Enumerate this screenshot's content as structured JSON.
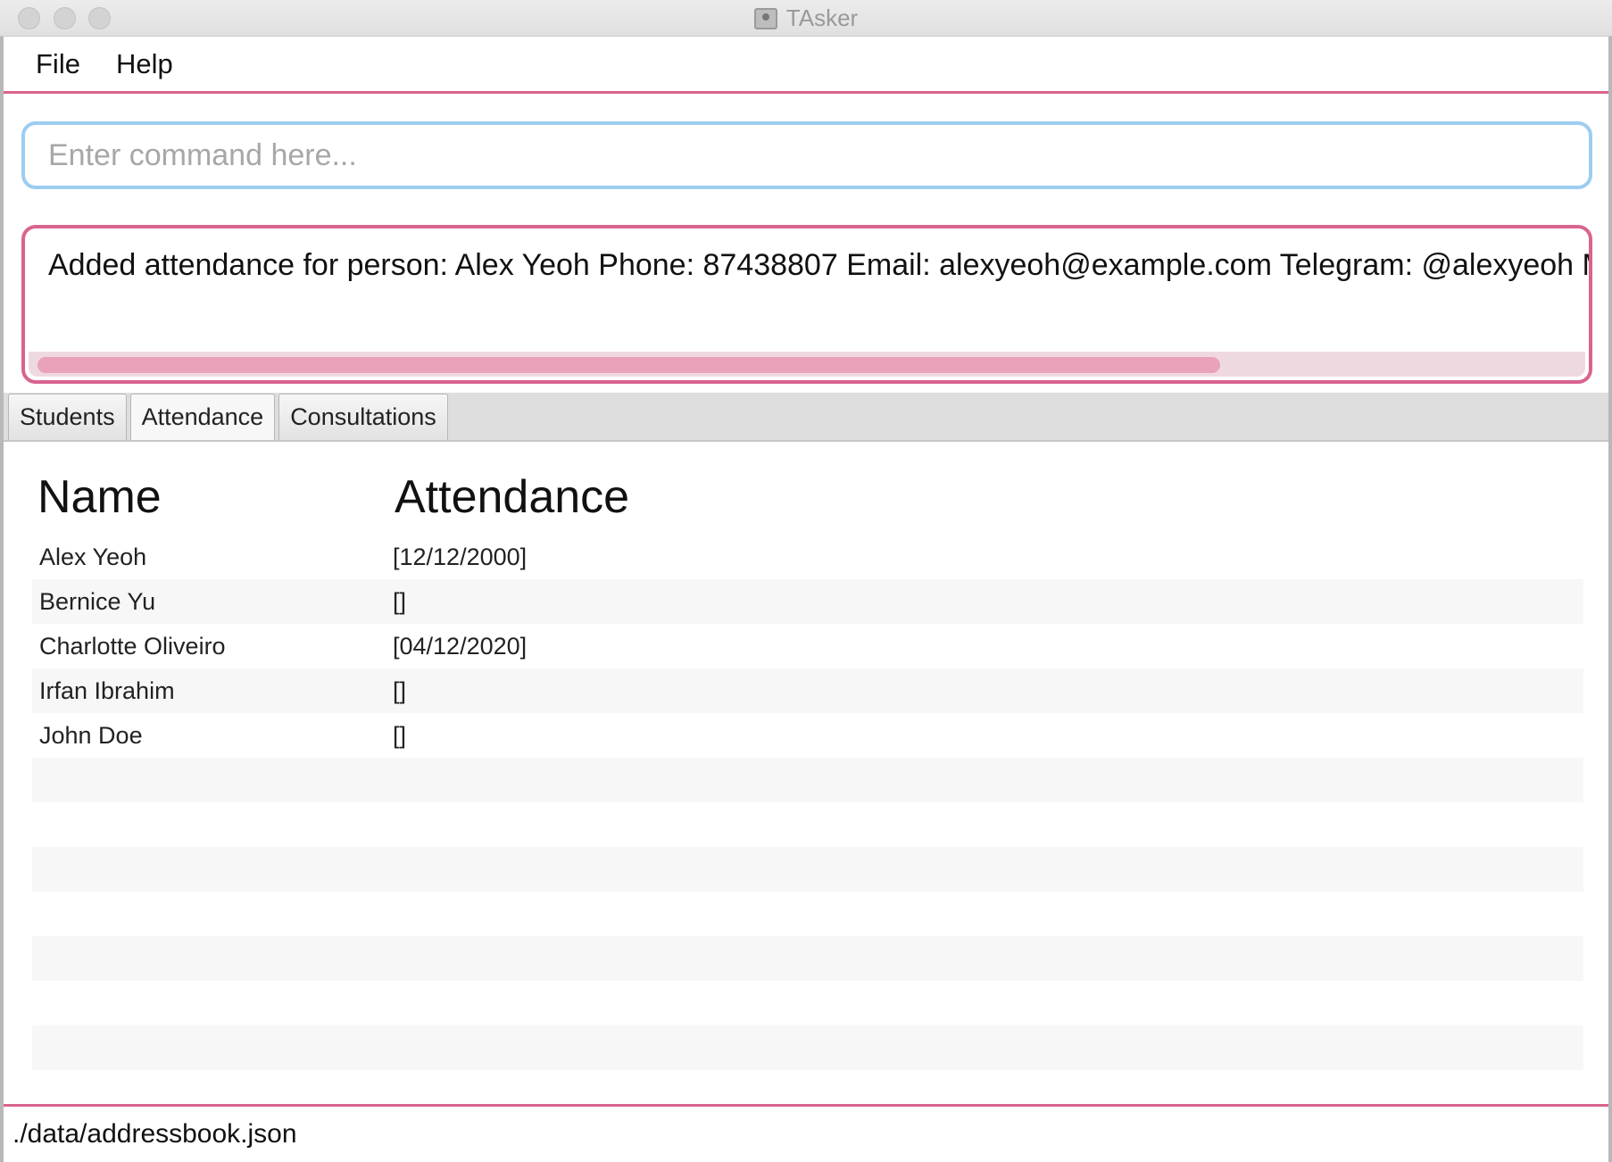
{
  "window": {
    "title": "TAsker"
  },
  "menu": {
    "items": [
      "File",
      "Help"
    ]
  },
  "command": {
    "placeholder": "Enter command here...",
    "value": ""
  },
  "result": {
    "text": "Added attendance for person: Alex Yeoh Phone: 87438807 Email: alexyeoh@example.com Telegram: @alexyeoh Matri"
  },
  "tabs": [
    {
      "label": "Students",
      "active": false
    },
    {
      "label": "Attendance",
      "active": true
    },
    {
      "label": "Consultations",
      "active": false
    }
  ],
  "table": {
    "headers": {
      "name": "Name",
      "attendance": "Attendance"
    },
    "rows": [
      {
        "name": "Alex Yeoh",
        "attendance": "[12/12/2000]"
      },
      {
        "name": "Bernice Yu",
        "attendance": "[]"
      },
      {
        "name": "Charlotte Oliveiro",
        "attendance": "[04/12/2020]"
      },
      {
        "name": "Irfan Ibrahim",
        "attendance": "[]"
      },
      {
        "name": "John Doe",
        "attendance": "[]"
      },
      {
        "name": "",
        "attendance": ""
      },
      {
        "name": "",
        "attendance": ""
      },
      {
        "name": "",
        "attendance": ""
      },
      {
        "name": "",
        "attendance": ""
      },
      {
        "name": "",
        "attendance": ""
      },
      {
        "name": "",
        "attendance": ""
      },
      {
        "name": "",
        "attendance": ""
      }
    ]
  },
  "status": {
    "path": "./data/addressbook.json"
  },
  "colors": {
    "accent": "#d9638f",
    "command_border": "#9ccdf0"
  }
}
